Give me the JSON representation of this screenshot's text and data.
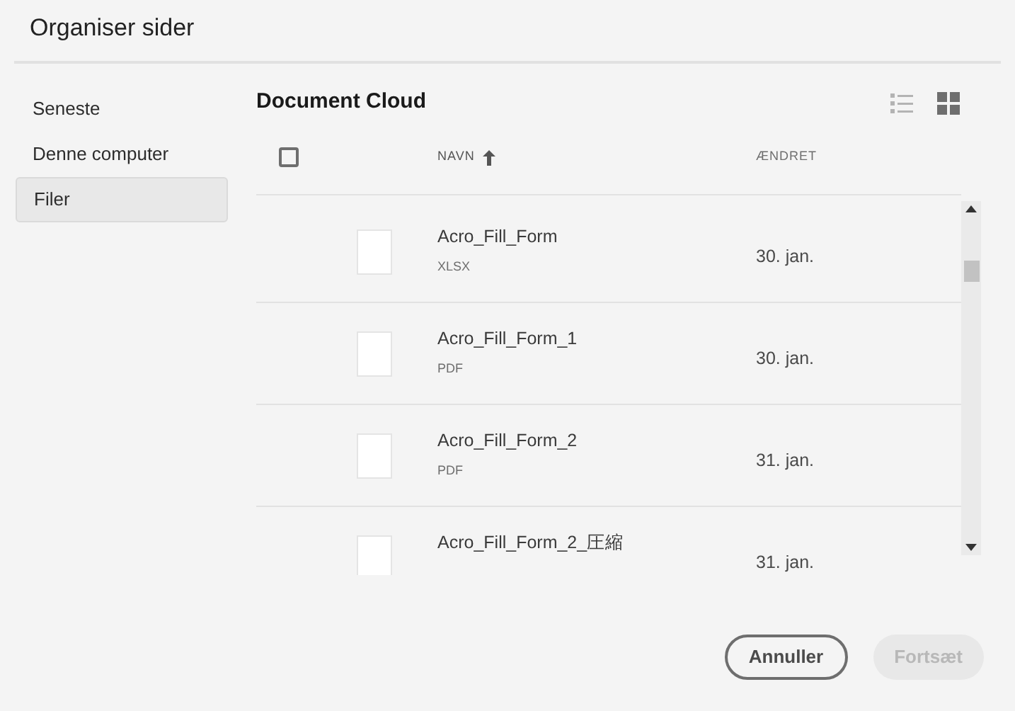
{
  "window": {
    "title": "Organiser sider"
  },
  "sidebar": {
    "items": [
      {
        "label": "Seneste",
        "selected": false
      },
      {
        "label": "Denne computer",
        "selected": false
      },
      {
        "label": "Filer",
        "selected": true
      }
    ]
  },
  "main": {
    "title": "Document Cloud",
    "views": [
      {
        "kind": "list",
        "selected": false
      },
      {
        "kind": "grid",
        "selected": true
      }
    ],
    "table": {
      "select_all": {
        "checked": false
      },
      "columns": [
        {
          "label": "NAVN",
          "sorted": true
        },
        {
          "label": "ÆNDRET",
          "sorted": false
        }
      ],
      "rows": [
        {
          "name": "Acro_Fill_Form",
          "type": "XLSX",
          "modified": "30. jan."
        },
        {
          "name": "Acro_Fill_Form_1",
          "type": "PDF",
          "modified": "30. jan."
        },
        {
          "name": "Acro_Fill_Form_2",
          "type": "PDF",
          "modified": "31. jan."
        },
        {
          "name": "Acro_Fill_Form_2_圧縮",
          "modified": "31. jan."
        }
      ]
    }
  },
  "buttons": [
    {
      "label": "Annuller",
      "disabled": false
    },
    {
      "label": "Fortsæt",
      "disabled": true
    }
  ]
}
